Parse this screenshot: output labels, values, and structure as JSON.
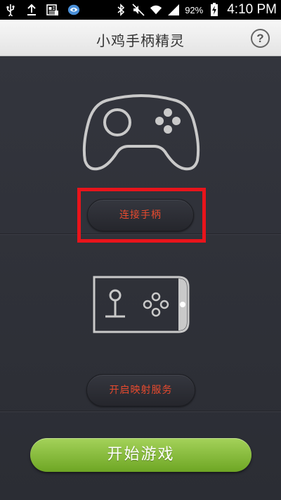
{
  "status_bar": {
    "icons_left": [
      "usb-icon",
      "upload-icon",
      "news-icon",
      "app-icon"
    ],
    "icons_right": [
      "bluetooth-icon",
      "mute-icon",
      "wifi-icon",
      "signal-icon",
      "battery-icon"
    ],
    "battery": "92%",
    "time": "4:10 PM"
  },
  "header": {
    "title": "小鸡手柄精灵",
    "help_label": "?"
  },
  "main": {
    "connect_label": "连接手柄",
    "mapping_label": "开启映射服务",
    "start_label": "开始游戏"
  },
  "colors": {
    "background": "#2e3038",
    "accent_red": "#e84a2e",
    "highlight": "#e8141b",
    "start_green": "#8bc34a"
  }
}
